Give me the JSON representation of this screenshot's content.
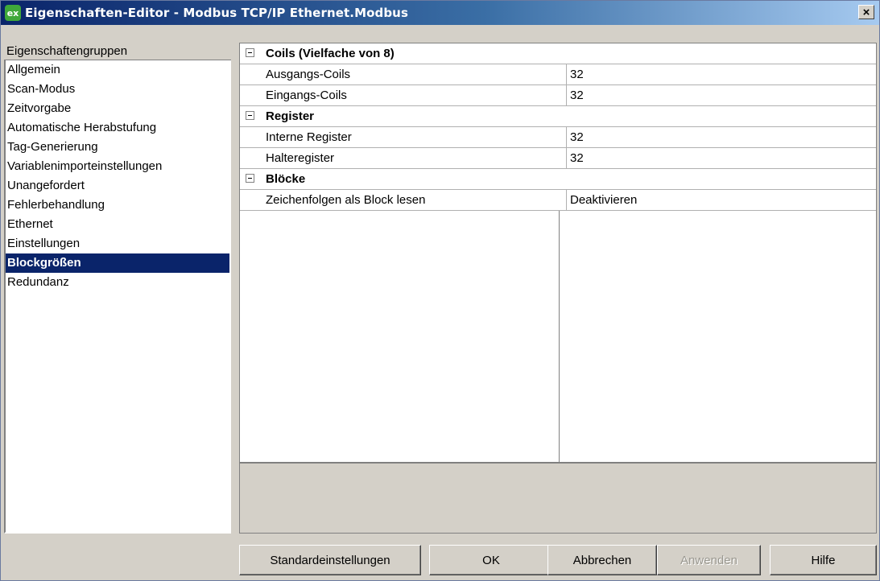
{
  "window": {
    "title": "Eigenschaften-Editor - Modbus TCP/IP Ethernet.Modbus",
    "icon_text": "ex",
    "close_label": "×"
  },
  "groups": {
    "header": "Eigenschaftengruppen",
    "items": [
      {
        "label": "Allgemein"
      },
      {
        "label": "Scan-Modus"
      },
      {
        "label": "Zeitvorgabe"
      },
      {
        "label": "Automatische Herabstufung"
      },
      {
        "label": "Tag-Generierung"
      },
      {
        "label": "Variablenimporteinstellungen"
      },
      {
        "label": "Unangefordert"
      },
      {
        "label": "Fehlerbehandlung"
      },
      {
        "label": "Ethernet"
      },
      {
        "label": "Einstellungen"
      },
      {
        "label": "Blockgrößen",
        "selected": true
      },
      {
        "label": "Redundanz"
      }
    ]
  },
  "properties": {
    "categories": [
      {
        "label": "Coils (Vielfache von 8)",
        "rows": [
          {
            "name": "Ausgangs-Coils",
            "value": "32"
          },
          {
            "name": "Eingangs-Coils",
            "value": "32"
          }
        ]
      },
      {
        "label": "Register",
        "rows": [
          {
            "name": "Interne Register",
            "value": "32"
          },
          {
            "name": "Halteregister",
            "value": "32"
          }
        ]
      },
      {
        "label": "Blöcke",
        "rows": [
          {
            "name": "Zeichenfolgen als Block lesen",
            "value": "Deaktivieren"
          }
        ]
      }
    ]
  },
  "buttons": {
    "defaults": "Standardeinstellungen",
    "ok": "OK",
    "cancel": "Abbrechen",
    "apply": "Anwenden",
    "help": "Hilfe"
  }
}
